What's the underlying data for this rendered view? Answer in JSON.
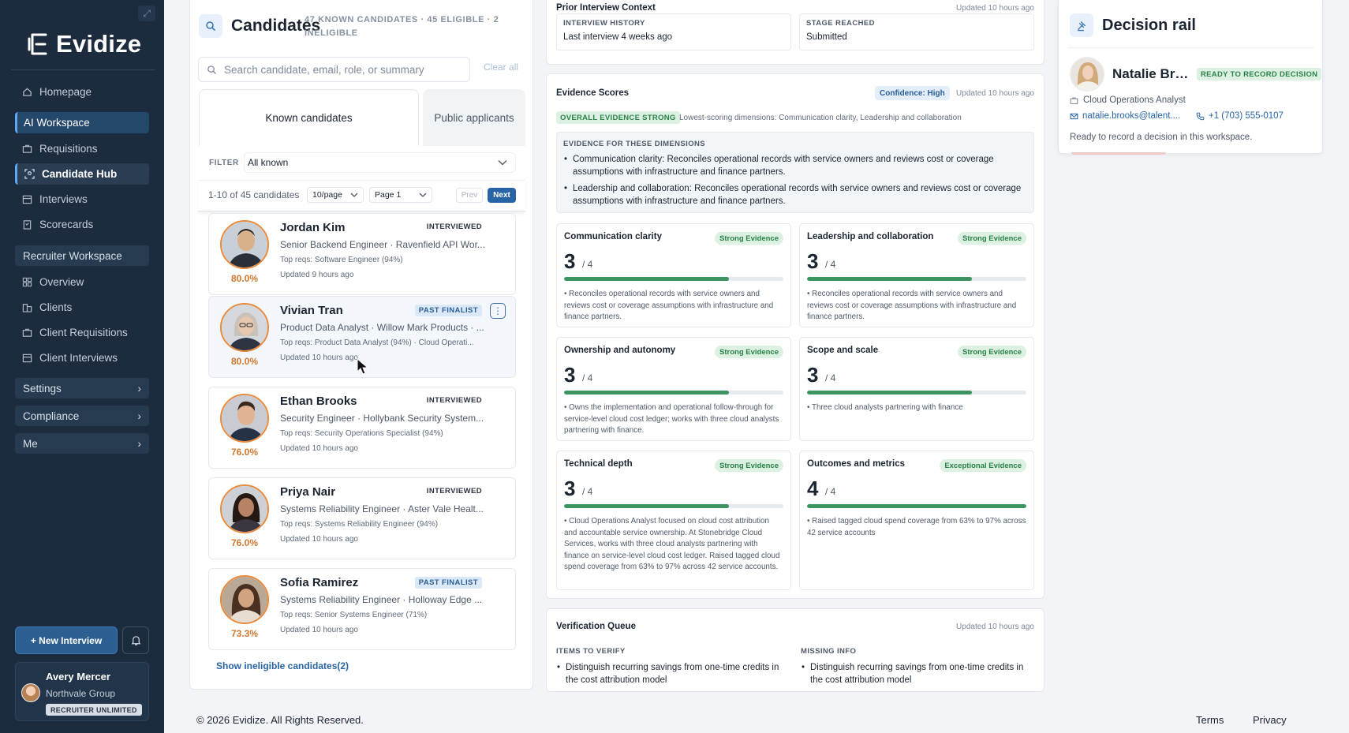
{
  "brand": {
    "name": "Evidize"
  },
  "sidebar": {
    "nav": [
      {
        "label": "Homepage",
        "icon": "home-icon"
      },
      {
        "label": "AI Workspace",
        "icon": ""
      },
      {
        "label": "Requisitions",
        "icon": "briefcase-icon"
      },
      {
        "label": "Candidate Hub",
        "icon": "candidate-scan-icon"
      },
      {
        "label": "Interviews",
        "icon": "calendar-icon"
      },
      {
        "label": "Scorecards",
        "icon": "clipboard-icon"
      },
      {
        "label": "Recruiter Workspace",
        "icon": ""
      },
      {
        "label": "Overview",
        "icon": "grid-icon"
      },
      {
        "label": "Clients",
        "icon": "building-icon"
      },
      {
        "label": "Client Requisitions",
        "icon": "briefcase-icon"
      },
      {
        "label": "Client Interviews",
        "icon": "calendar-icon"
      }
    ],
    "groups": [
      {
        "label": "Settings"
      },
      {
        "label": "Compliance"
      },
      {
        "label": "Me"
      }
    ],
    "new_interview": "+ New Interview",
    "user": {
      "name": "Avery Mercer",
      "org": "Northvale Group",
      "badge": "RECRUITER UNLIMITED"
    }
  },
  "candidates": {
    "title": "Candidates",
    "meta": "47 KNOWN CANDIDATES · 45 ELIGIBLE · 2 INELIGIBLE",
    "search_placeholder": "Search candidate, email, role, or summary",
    "clear_all": "Clear all",
    "tabs": [
      "Known candidates",
      "Public applicants"
    ],
    "filter_label": "FILTER",
    "filter_value": "All known",
    "pager": {
      "count": "1-10 of 45 candidates",
      "per_page": "10/page",
      "page": "Page 1",
      "prev": "Prev",
      "next": "Next"
    },
    "list": [
      {
        "name": "Jordan Kim",
        "status": "INTERVIEWED",
        "role": "Senior Backend Engineer · Ravenfield API Wor...",
        "reqs": "Top reqs: Software Engineer (94%)",
        "updated": "Updated 9 hours ago",
        "score": "80.0%"
      },
      {
        "name": "Vivian Tran",
        "status": "PAST FINALIST",
        "role": "Product Data Analyst · Willow Mark Products · ...",
        "reqs": "Top reqs: Product Data Analyst (94%) · Cloud Operati...",
        "updated": "Updated 10 hours ago",
        "score": "80.0%"
      },
      {
        "name": "Ethan Brooks",
        "status": "INTERVIEWED",
        "role": "Security Engineer · Hollybank Security System...",
        "reqs": "Top reqs: Security Operations Specialist (94%)",
        "updated": "Updated 10 hours ago",
        "score": "76.0%"
      },
      {
        "name": "Priya Nair",
        "status": "INTERVIEWED",
        "role": "Systems Reliability Engineer · Aster Vale Healt...",
        "reqs": "Top reqs: Systems Reliability Engineer (94%)",
        "updated": "Updated 10 hours ago",
        "score": "76.0%"
      },
      {
        "name": "Sofia Ramirez",
        "status": "PAST FINALIST",
        "role": "Systems Reliability Engineer · Holloway Edge ...",
        "reqs": "Top reqs: Senior Systems Engineer (71%)",
        "updated": "Updated 10 hours ago",
        "score": "73.3%"
      }
    ],
    "show_ineligible": "Show ineligible candidates(2)"
  },
  "prior_context": {
    "title": "Prior Interview Context",
    "updated": "Updated 10 hours ago",
    "history_label": "INTERVIEW HISTORY",
    "history_value": "Last interview 4 weeks ago",
    "stage_label": "STAGE REACHED",
    "stage_value": "Submitted"
  },
  "evidence": {
    "title": "Evidence Scores",
    "confidence": "Confidence: High",
    "updated": "Updated 10 hours ago",
    "overall": "OVERALL EVIDENCE STRONG",
    "lowest": "Lowest-scoring dimensions: Communication clarity, Leadership and collaboration",
    "box_head": "EVIDENCE FOR THESE DIMENSIONS",
    "box_items": [
      "Communication clarity: Reconciles operational records with service owners and reviews cost or coverage assumptions with infrastructure and finance partners.",
      "Leadership and collaboration: Reconciles operational records with service owners and reviews cost or coverage assumptions with infrastructure and finance partners."
    ],
    "dimensions": [
      {
        "name": "Communication clarity",
        "level": "Strong Evidence",
        "score": "3",
        "of": "/ 4",
        "value": 3,
        "max": 4,
        "text": "• Reconciles operational records with service owners and reviews cost or coverage assumptions with infrastructure and finance partners."
      },
      {
        "name": "Leadership and collaboration",
        "level": "Strong Evidence",
        "score": "3",
        "of": "/ 4",
        "value": 3,
        "max": 4,
        "text": "• Reconciles operational records with service owners and reviews cost or coverage assumptions with infrastructure and finance partners."
      },
      {
        "name": "Ownership and autonomy",
        "level": "Strong Evidence",
        "score": "3",
        "of": "/ 4",
        "value": 3,
        "max": 4,
        "text": "• Owns the implementation and operational follow-through for service-level cloud cost ledger; works with three cloud analysts partnering with finance."
      },
      {
        "name": "Scope and scale",
        "level": "Strong Evidence",
        "score": "3",
        "of": "/ 4",
        "value": 3,
        "max": 4,
        "text": "• Three cloud analysts partnering with finance"
      },
      {
        "name": "Technical depth",
        "level": "Strong Evidence",
        "score": "3",
        "of": "/ 4",
        "value": 3,
        "max": 4,
        "text": "• Cloud Operations Analyst focused on cloud cost attribution and accountable service ownership. At Stonebridge Cloud Services, works with three cloud analysts partnering with finance on service-level cloud cost ledger. Raised tagged cloud spend coverage from 63% to 97% across 42 service accounts."
      },
      {
        "name": "Outcomes and metrics",
        "level": "Exceptional Evidence",
        "score": "4",
        "of": "/ 4",
        "value": 4,
        "max": 4,
        "text": "• Raised tagged cloud spend coverage from 63% to 97% across 42 service accounts"
      }
    ]
  },
  "verification": {
    "title": "Verification Queue",
    "updated": "Updated 10 hours ago",
    "verify_label": "ITEMS TO VERIFY",
    "verify_item": "Distinguish recurring savings from one-time credits in the cost attribution model",
    "missing_label": "MISSING INFO",
    "missing_item": "Distinguish recurring savings from one-time credits in the cost attribution model"
  },
  "decision_rail": {
    "title": "Decision rail",
    "name": "Natalie Brooks",
    "ready_badge": "READY TO RECORD DECISION",
    "role": "Cloud Operations Analyst",
    "email": "natalie.brooks@talent....",
    "phone": "+1 (703) 555-0107",
    "ready_text": "Ready to record a decision in this workspace."
  },
  "footer": {
    "copyright": "© 2026  Evidize. All Rights Reserved.",
    "terms": "Terms",
    "privacy": "Privacy"
  }
}
